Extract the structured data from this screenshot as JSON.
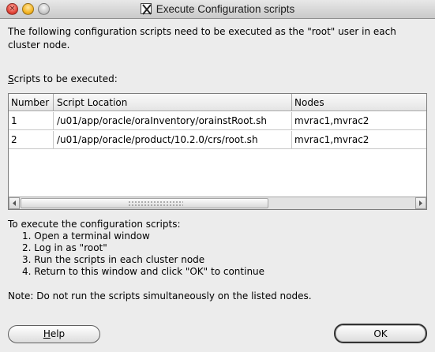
{
  "window": {
    "title": "Execute Configuration scripts",
    "close_glyph": "×"
  },
  "intro_text": "The following configuration scripts need to be executed as the \"root\" user in each cluster node.",
  "scripts_label": {
    "mnemonic": "S",
    "rest": "cripts to be executed:"
  },
  "table": {
    "columns": [
      "Number",
      "Script Location",
      "Nodes"
    ],
    "rows": [
      {
        "number": "1",
        "location": "/u01/app/oracle/oraInventory/orainstRoot.sh",
        "nodes": "mvrac1,mvrac2"
      },
      {
        "number": "2",
        "location": "/u01/app/oracle/product/10.2.0/crs/root.sh",
        "nodes": "mvrac1,mvrac2"
      }
    ]
  },
  "instructions": {
    "heading": "To execute the configuration scripts:",
    "steps": [
      "1. Open a terminal window",
      "2. Log in as \"root\"",
      "3. Run the scripts in each cluster node",
      "4. Return to this window and click \"OK\" to continue"
    ]
  },
  "note": "Note: Do not run the scripts simultaneously on the listed nodes.",
  "buttons": {
    "help": {
      "mnemonic": "H",
      "rest": "elp"
    },
    "ok": "OK"
  },
  "scrollbar": {
    "thumb_fraction": 0.63
  }
}
